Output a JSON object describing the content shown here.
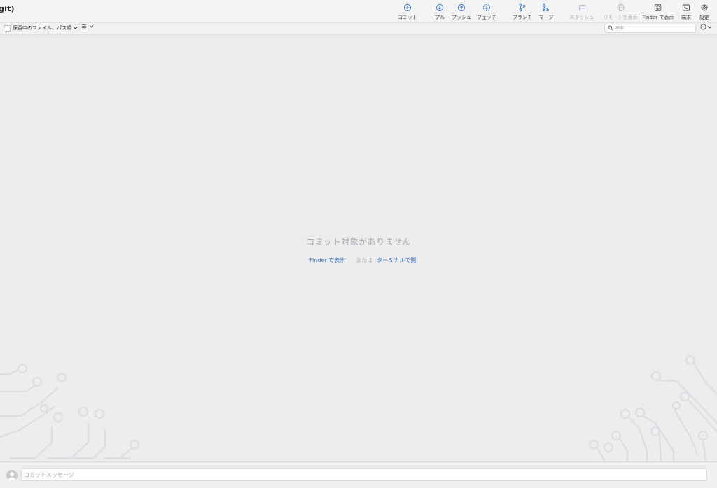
{
  "window": {
    "title": "git)"
  },
  "toolbar": {
    "commit": "コミット",
    "pull": "プル",
    "push": "プッシュ",
    "fetch": "フェッチ",
    "branch": "ブランチ",
    "merge": "マージ",
    "stash": "スタッシュ",
    "show_remote": "リモートを表示",
    "show_in_finder": "Finder で表示",
    "terminal": "端末",
    "settings": "設定"
  },
  "icons": {
    "commit": "plus-circle-icon",
    "pull": "arrow-down-circle-icon",
    "push": "arrow-up-circle-icon",
    "fetch": "arrow-down-circle-icon",
    "branch": "branch-icon",
    "merge": "merge-icon",
    "stash": "stash-icon",
    "show_remote": "globe-icon",
    "show_in_finder": "finder-icon",
    "terminal": "terminal-icon",
    "settings": "gear-icon"
  },
  "filterbar": {
    "pending_sort": "保留中のファイル、パス順",
    "search_placeholder": "検索"
  },
  "empty_state": {
    "title": "コミット対象がありません",
    "finder_link": "Finder で表示",
    "or": "または",
    "terminal_link": "ターミナルで開"
  },
  "commit_bar": {
    "placeholder": "コミットメッセージ"
  },
  "colors": {
    "accent": "#2f6fd0",
    "background": "#ecedee",
    "muted_text": "#a4a6aa",
    "circuit": "#dcdde0"
  }
}
